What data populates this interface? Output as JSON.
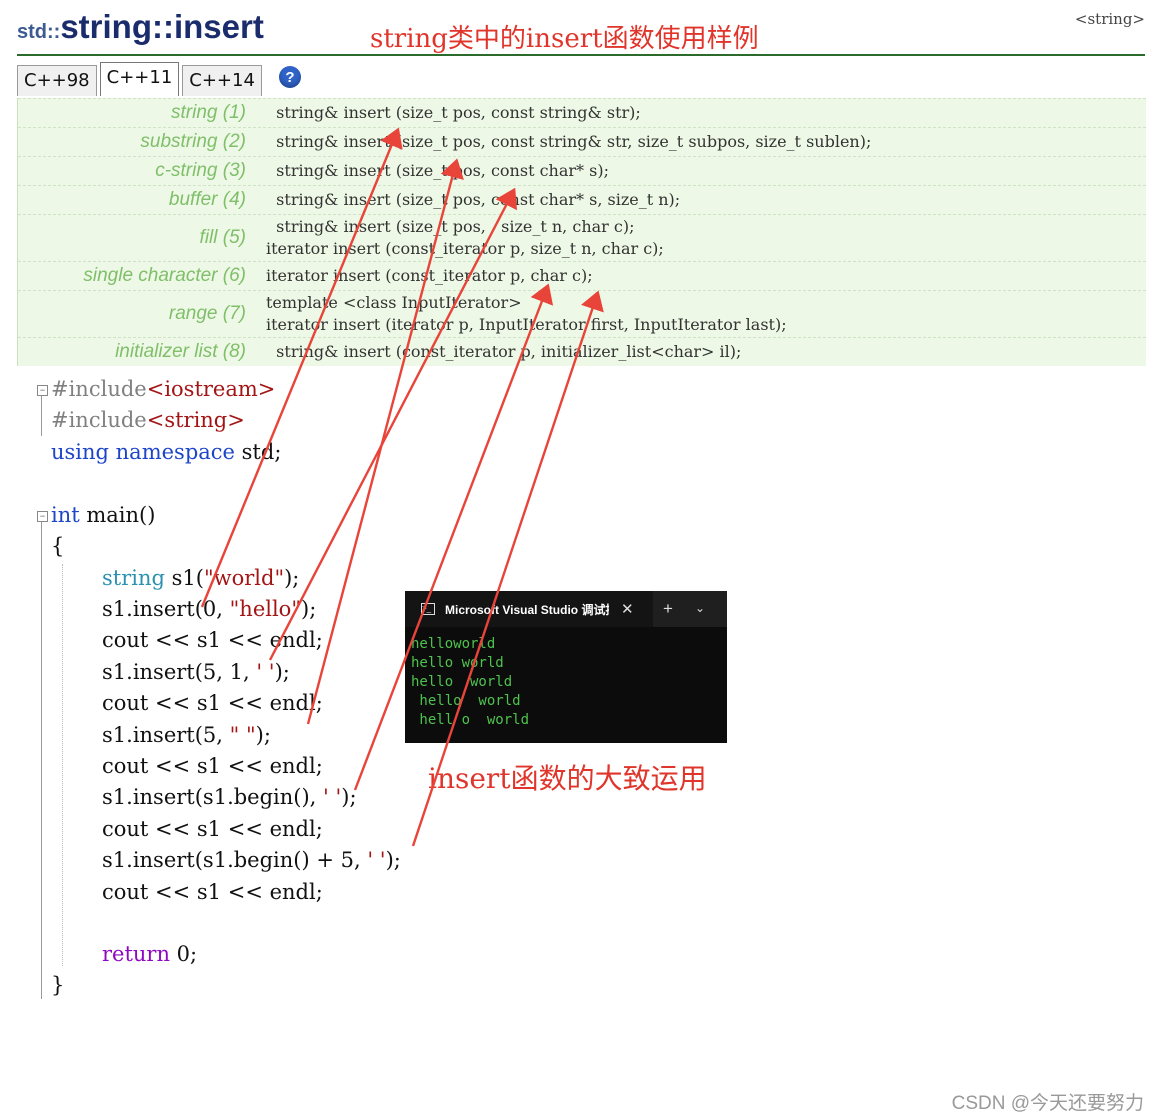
{
  "header": {
    "namespace": "std::",
    "name": "string::insert",
    "note": "string类中的insert函数使用样例",
    "reference": "<string>"
  },
  "tabs": [
    {
      "label": "C++98",
      "active": false
    },
    {
      "label": "C++11",
      "active": true
    },
    {
      "label": "C++14",
      "active": false
    }
  ],
  "help_icon": "help-icon",
  "declarations": [
    {
      "name": "string (1)",
      "lines": [
        "  string& insert (size_t pos, const string& str);"
      ]
    },
    {
      "name": "substring (2)",
      "lines": [
        "  string& insert (size_t pos, const string& str, size_t subpos, size_t sublen);"
      ]
    },
    {
      "name": "c-string (3)",
      "lines": [
        "  string& insert (size_t pos, const char* s);"
      ]
    },
    {
      "name": "buffer (4)",
      "lines": [
        "  string& insert (size_t pos, const char* s, size_t n);"
      ]
    },
    {
      "name": "fill (5)",
      "lines": [
        "  string& insert (size_t pos,   size_t n, char c);",
        "iterator insert (const_iterator p, size_t n, char c);"
      ]
    },
    {
      "name": "single character (6)",
      "lines": [
        "iterator insert (const_iterator p, char c);"
      ]
    },
    {
      "name": "range (7)",
      "lines": [
        "template <class InputIterator>",
        "iterator insert (iterator p, InputIterator first, InputIterator last);"
      ]
    },
    {
      "name": "initializer list (8)",
      "lines": [
        "  string& insert (const_iterator p, initializer_list<char> il);"
      ]
    }
  ],
  "code": {
    "include1_kw": "#include",
    "include1_hdr": "<iostream>",
    "include2_kw": "#include",
    "include2_hdr": "<string>",
    "using_kw": "using namespace",
    "using_rest": " std;",
    "int_kw": "int",
    "main_sig": " main()",
    "open_brace": "{",
    "line_decl_type": "string",
    "line_decl_var": " s1(",
    "line_decl_str": "\"world\"",
    "line_decl_end": ");",
    "ins1_a": "s1.insert(0, ",
    "ins1_str": "\"hello\"",
    "ins1_end": ");",
    "cout_line": "cout << s1 << endl;",
    "ins2_a": "s1.insert(5, 1, ",
    "ins2_str": "' '",
    "ins2_end": ");",
    "ins3_a": "s1.insert(5, ",
    "ins3_str": "\" \"",
    "ins3_end": ");",
    "ins4_a": "s1.insert(s1.begin(), ",
    "ins4_str": "' '",
    "ins4_end": ");",
    "ins5_a": "s1.insert(s1.begin() + 5, ",
    "ins5_str": "' '",
    "ins5_end": ");",
    "return_kw": "return",
    "return_rest": " 0;",
    "close_brace": "}"
  },
  "console": {
    "title": "Microsoft Visual Studio 调试控制台",
    "close_glyph": "✕",
    "plus_glyph": "+",
    "dropdown_glyph": "⌄",
    "output": [
      "helloworld",
      "hello world",
      "hello  world",
      " hello  world",
      " hell o  world"
    ]
  },
  "body_note": "insert函数的大致运用",
  "watermark": "CSDN @今天还要努力",
  "colors": {
    "annotation": "#e0352b",
    "decl_bg": "#eef8e6",
    "console_text": "#4ec24e",
    "keyword": "#1d45c8",
    "type": "#2b91af",
    "string": "#a31515"
  }
}
